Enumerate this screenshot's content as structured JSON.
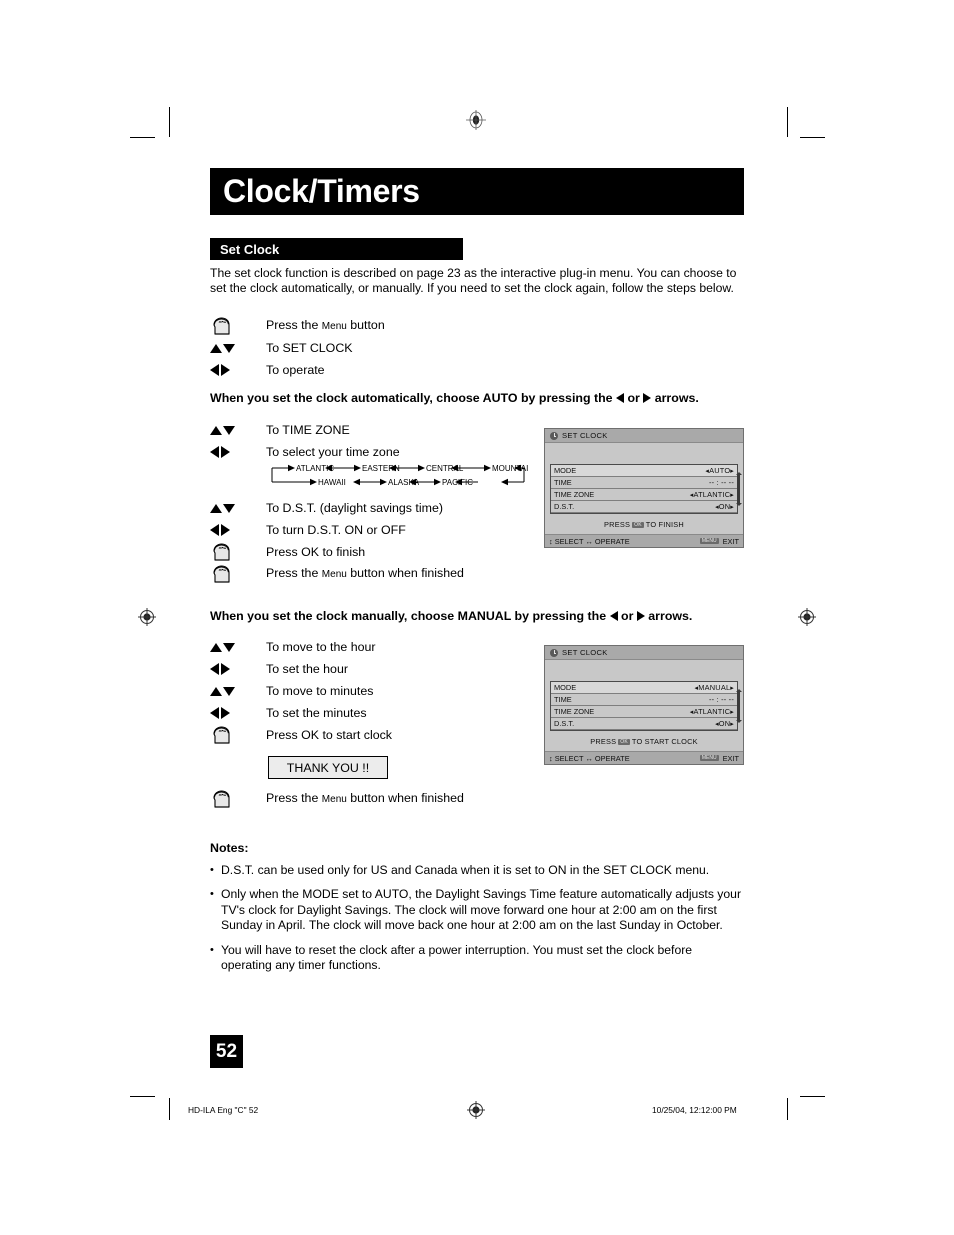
{
  "header": {
    "title": "Clock/Timers",
    "section": "Set Clock"
  },
  "intro": "The set clock function is described on page 23 as the interactive plug-in menu. You can choose to set the clock automatically, or manually. If you need to set the clock again, follow the steps below.",
  "steps_intro": [
    {
      "icon": "hand-press-icon",
      "pre": "Press the ",
      "small": "Menu",
      "post": " button"
    },
    {
      "icon": "up-down-arrow-icon",
      "pre": "To SET CLOCK",
      "small": "",
      "post": ""
    },
    {
      "icon": "left-right-arrow-icon",
      "pre": "To operate",
      "small": "",
      "post": ""
    }
  ],
  "auto_heading": {
    "part1": "When you set the clock automatically, choose AUTO by pressing the ",
    "part2": " or ",
    "part3": " arrows."
  },
  "steps_auto": [
    {
      "icon": "up-down-arrow-icon",
      "pre": "To TIME ZONE",
      "small": "",
      "post": ""
    },
    {
      "icon": "left-right-arrow-icon",
      "pre": "To select your time zone",
      "small": "",
      "post": ""
    }
  ],
  "steps_auto2": [
    {
      "icon": "up-down-arrow-icon",
      "pre": "To D.S.T. (daylight savings time)",
      "small": "",
      "post": ""
    },
    {
      "icon": "left-right-arrow-icon",
      "pre": "To turn D.S.T. ON or OFF",
      "small": "",
      "post": ""
    },
    {
      "icon": "hand-press-icon",
      "pre": "Press OK to finish",
      "small": "",
      "post": ""
    },
    {
      "icon": "hand-press-icon",
      "pre": "Press the ",
      "small": "Menu",
      "post": " button when finished"
    }
  ],
  "timezone_diagram": {
    "top_row": [
      "ATLANTIC",
      "EASTERN",
      "CENTRAL",
      "MOUNTAIN"
    ],
    "bottom_row": [
      "HAWAII",
      "ALASKA",
      "PACIFIC"
    ]
  },
  "manual_heading": {
    "part1": "When you set the clock manually, choose MANUAL by pressing the ",
    "part2": " or ",
    "part3": " arrows."
  },
  "steps_manual": [
    {
      "icon": "up-down-arrow-icon",
      "pre": "To move to the hour",
      "small": "",
      "post": ""
    },
    {
      "icon": "left-right-arrow-icon",
      "pre": "To set the hour",
      "small": "",
      "post": ""
    },
    {
      "icon": "up-down-arrow-icon",
      "pre": "To move to minutes",
      "small": "",
      "post": ""
    },
    {
      "icon": "left-right-arrow-icon",
      "pre": "To set the minutes",
      "small": "",
      "post": ""
    },
    {
      "icon": "hand-press-icon",
      "pre": "Press OK to start clock",
      "small": "",
      "post": ""
    }
  ],
  "thank_you": "THANK YOU !!",
  "steps_manual_end": [
    {
      "icon": "hand-press-icon",
      "pre": "Press the ",
      "small": "Menu",
      "post": " button when finished"
    }
  ],
  "osd_auto": {
    "title": "SET CLOCK",
    "rows": [
      {
        "label": "MODE",
        "value": "AUTO",
        "chevrons": true,
        "selected": true
      },
      {
        "label": "TIME",
        "value": "-- : -- --",
        "chevrons": false,
        "selected": false
      },
      {
        "label": "TIME ZONE",
        "value": "ATLANTIC",
        "chevrons": true,
        "selected": false
      },
      {
        "label": "D.S.T.",
        "value": "ON",
        "chevrons": true,
        "selected": false
      }
    ],
    "hint_pre": "PRESS",
    "hint_key": "OK",
    "hint_post": "TO FINISH",
    "footer_select": "SELECT",
    "footer_operate": "OPERATE",
    "footer_menu_key": "MENU",
    "footer_exit": "EXIT"
  },
  "osd_manual": {
    "title": "SET CLOCK",
    "rows": [
      {
        "label": "MODE",
        "value": "MANUAL",
        "chevrons": true,
        "selected": true
      },
      {
        "label": "TIME",
        "value": "-- : -- --",
        "chevrons": false,
        "selected": false
      },
      {
        "label": "TIME ZONE",
        "value": "ATLANTIC",
        "chevrons": true,
        "selected": false
      },
      {
        "label": "D.S.T.",
        "value": "ON",
        "chevrons": true,
        "selected": false
      }
    ],
    "hint_pre": "PRESS",
    "hint_key": "OK",
    "hint_post": "TO START CLOCK",
    "footer_select": "SELECT",
    "footer_operate": "OPERATE",
    "footer_menu_key": "MENU",
    "footer_exit": "EXIT"
  },
  "notes": {
    "title": "Notes:",
    "items": [
      "D.S.T. can be used only for US and Canada when it is set to ON in the SET CLOCK menu.",
      "Only when the MODE set to AUTO, the Daylight Savings Time feature automatically adjusts your TV's clock for Daylight Savings. The clock will move forward one hour at 2:00 am on the first Sunday in April. The clock will move back one hour at 2:00 am on the last Sunday in October.",
      "You will have to reset the clock after a power interruption. You must set the clock before operating any timer functions."
    ],
    "bullet": "•"
  },
  "page_number": "52",
  "footer": {
    "left": "HD-ILA Eng \"C\"   52",
    "right": "10/25/04, 12:12:00 PM"
  }
}
